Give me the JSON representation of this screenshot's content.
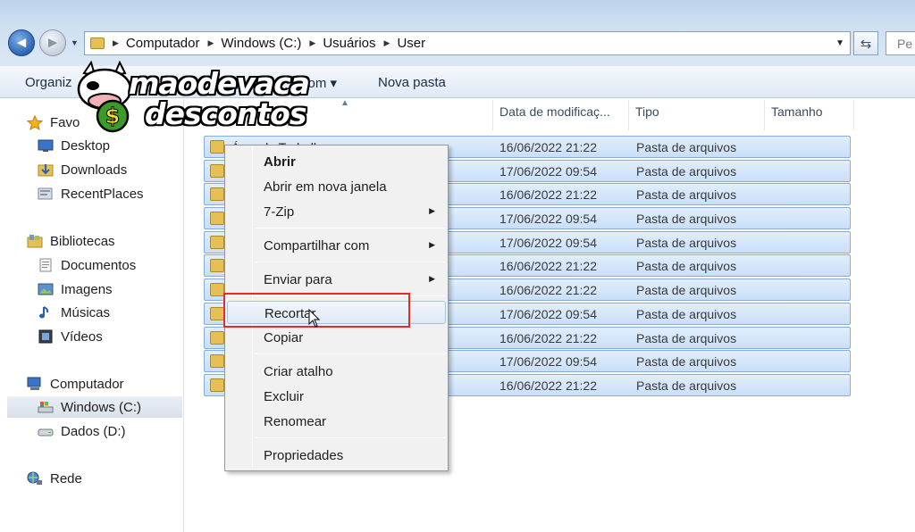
{
  "navigation": {
    "back_glyph": "◄",
    "forward_glyph": "►",
    "history_glyph": "▼"
  },
  "address": {
    "crumbs": [
      "Computador",
      "Windows (C:)",
      "Usuários",
      "User"
    ],
    "separator": "▶",
    "dropdown_glyph": "▼",
    "refresh_glyph": "⇆",
    "search_placeholder": "Pe"
  },
  "toolbar": {
    "organize_label": "Organiz",
    "share_label": "com",
    "share_arrow": "▾",
    "new_folder_label": "Nova pasta"
  },
  "watermark": {
    "line1": "maodevaca",
    "line2": "descontos"
  },
  "sidebar": {
    "favorites_label": "Favo",
    "favorites": [
      {
        "label": "Desktop",
        "icon": "desktop-icon"
      },
      {
        "label": "Downloads",
        "icon": "downloads-icon"
      },
      {
        "label": "RecentPlaces",
        "icon": "recent-places-icon"
      }
    ],
    "libraries_label": "Bibliotecas",
    "libraries": [
      {
        "label": "Documentos",
        "icon": "documents-icon"
      },
      {
        "label": "Imagens",
        "icon": "pictures-icon"
      },
      {
        "label": "Músicas",
        "icon": "music-icon"
      },
      {
        "label": "Vídeos",
        "icon": "videos-icon"
      }
    ],
    "computer_label": "Computador",
    "drives": [
      {
        "label": "Windows (C:)",
        "icon": "drive-c-icon",
        "selected": true
      },
      {
        "label": "Dados (D:)",
        "icon": "drive-d-icon",
        "selected": false
      }
    ],
    "network_label": "Rede"
  },
  "columns": {
    "date": "Data de modificaç...",
    "type": "Tipo",
    "size": "Tamanho",
    "sort_glyph": "▲"
  },
  "files": [
    {
      "name": "Área de Trabalho",
      "date": "16/06/2022 21:22",
      "type": "Pasta de arquivos"
    },
    {
      "name": "",
      "date": "17/06/2022 09:54",
      "type": "Pasta de arquivos"
    },
    {
      "name": "",
      "date": "16/06/2022 21:22",
      "type": "Pasta de arquivos"
    },
    {
      "name": "",
      "date": "17/06/2022 09:54",
      "type": "Pasta de arquivos"
    },
    {
      "name": "",
      "date": "17/06/2022 09:54",
      "type": "Pasta de arquivos"
    },
    {
      "name": "",
      "date": "16/06/2022 21:22",
      "type": "Pasta de arquivos"
    },
    {
      "name": "",
      "date": "16/06/2022 21:22",
      "type": "Pasta de arquivos"
    },
    {
      "name": "",
      "date": "17/06/2022 09:54",
      "type": "Pasta de arquivos"
    },
    {
      "name": "",
      "date": "16/06/2022 21:22",
      "type": "Pasta de arquivos"
    },
    {
      "name": "",
      "date": "17/06/2022 09:54",
      "type": "Pasta de arquivos"
    },
    {
      "name": "",
      "date": "16/06/2022 21:22",
      "type": "Pasta de arquivos"
    }
  ],
  "context_menu": {
    "items": [
      {
        "label": "Abrir",
        "bold": true,
        "submenu": false
      },
      {
        "label": "Abrir em nova janela",
        "bold": false,
        "submenu": false
      },
      {
        "label": "7-Zip",
        "bold": false,
        "submenu": true
      },
      {
        "label": "Compartilhar com",
        "bold": false,
        "submenu": true
      },
      {
        "label": "Enviar para",
        "bold": false,
        "submenu": true
      },
      {
        "label": "Recortar",
        "bold": false,
        "submenu": false,
        "hover": true
      },
      {
        "label": "Copiar",
        "bold": false,
        "submenu": false
      },
      {
        "label": "Criar atalho",
        "bold": false,
        "submenu": false
      },
      {
        "label": "Excluir",
        "bold": false,
        "submenu": false
      },
      {
        "label": "Renomear",
        "bold": false,
        "submenu": false
      },
      {
        "label": "Propriedades",
        "bold": false,
        "submenu": false
      }
    ],
    "submenu_glyph": "▶"
  },
  "colors": {
    "selection_fill": "#c9dff8",
    "selection_border": "#84acdd",
    "highlight_box": "#e32b2b"
  }
}
